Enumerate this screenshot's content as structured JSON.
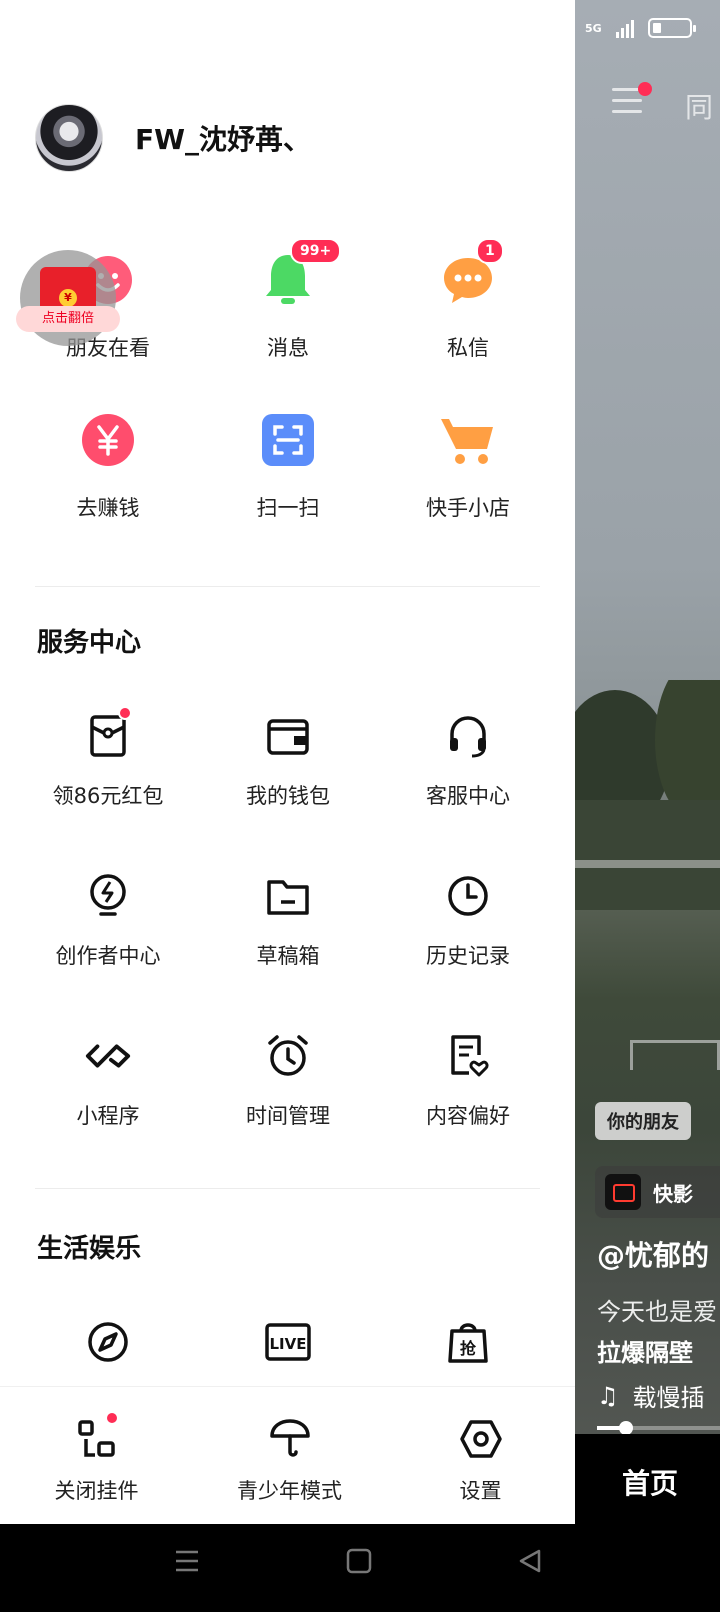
{
  "status_bar": {
    "network": "5G"
  },
  "profile": {
    "username": "FW_沈妤苒、"
  },
  "quick_actions": [
    {
      "label": "朋友在看",
      "icon": "smile-icon"
    },
    {
      "label": "消息",
      "icon": "bell-icon",
      "badge": "99+"
    },
    {
      "label": "私信",
      "icon": "chat-bubble-icon",
      "badge": "1"
    },
    {
      "label": "去赚钱",
      "icon": "yuan-coin-icon"
    },
    {
      "label": "扫一扫",
      "icon": "scan-icon"
    },
    {
      "label": "快手小店",
      "icon": "shopping-cart-icon"
    }
  ],
  "floating_red_packet": {
    "label": "点击翻倍",
    "seal": "¥"
  },
  "service_center": {
    "title": "服务中心",
    "items": [
      {
        "label": "领86元红包",
        "icon": "red-packet-icon",
        "dot": true
      },
      {
        "label": "我的钱包",
        "icon": "wallet-icon"
      },
      {
        "label": "客服中心",
        "icon": "headset-icon"
      },
      {
        "label": "创作者中心",
        "icon": "lightbulb-icon"
      },
      {
        "label": "草稿箱",
        "icon": "folder-icon"
      },
      {
        "label": "历史记录",
        "icon": "clock-icon"
      },
      {
        "label": "小程序",
        "icon": "infinity-icon"
      },
      {
        "label": "时间管理",
        "icon": "alarm-clock-icon"
      },
      {
        "label": "内容偏好",
        "icon": "document-heart-icon"
      }
    ]
  },
  "life_entertainment": {
    "title": "生活娱乐",
    "items": [
      {
        "icon": "compass-icon"
      },
      {
        "icon": "live-icon",
        "text": "LIVE"
      },
      {
        "icon": "grab-bag-icon",
        "text": "抢"
      }
    ]
  },
  "bottom_bar": [
    {
      "label": "关闭挂件",
      "icon": "widget-icon",
      "dot": true
    },
    {
      "label": "青少年模式",
      "icon": "umbrella-icon"
    },
    {
      "label": "设置",
      "icon": "hexagon-settings-icon"
    }
  ],
  "feed": {
    "top_tab": "同",
    "friend_chip": "你的朋友",
    "app_name": "快影",
    "author": "@忧郁的",
    "caption_line1": "今天也是爱",
    "caption_line2": "拉爆隔壁",
    "music": "载慢插",
    "progress_fraction": 0.2,
    "bottom_tab": "首页"
  },
  "colors": {
    "accent_red": "#ff2d55",
    "bell_green": "#4cd964",
    "chat_orange": "#ff9f43",
    "yuan_pink": "#ff4d6d",
    "scan_blue": "#5b8dfa",
    "cart_orange": "#ff9f43"
  }
}
